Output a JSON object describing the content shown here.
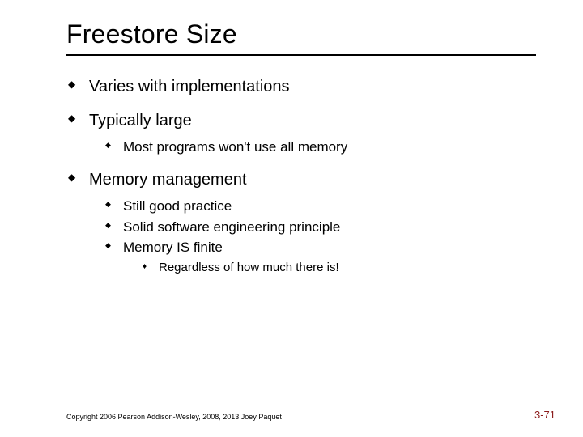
{
  "title": "Freestore Size",
  "bullets": {
    "b1": "Varies with implementations",
    "b2": "Typically large",
    "b2_1": "Most programs won't use all memory",
    "b3": "Memory management",
    "b3_1": "Still good practice",
    "b3_2": "Solid software engineering principle",
    "b3_3": "Memory IS finite",
    "b3_3_1": "Regardless of how much there is!"
  },
  "footer": "Copyright 2006 Pearson Addison-Wesley, 2008, 2013 Joey Paquet",
  "page_number": "3-71"
}
